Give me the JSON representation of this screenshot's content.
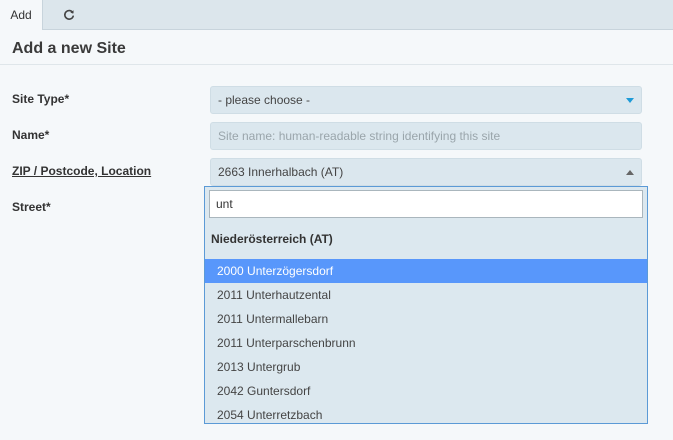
{
  "tabs": {
    "add_label": "Add"
  },
  "page": {
    "title": "Add a new Site"
  },
  "form": {
    "site_type": {
      "label": "Site Type*",
      "value": "- please choose -"
    },
    "name": {
      "label": "Name*",
      "value": "",
      "placeholder": "Site name: human-readable string identifying this site"
    },
    "location": {
      "label": "ZIP / Postcode, Location",
      "value": "2663 Innerhalbach (AT)"
    },
    "street": {
      "label": "Street*"
    }
  },
  "dropdown": {
    "search_value": "unt",
    "group_label": "Niederösterreich (AT)",
    "options": [
      "2000 Unterzögersdorf",
      "2011 Unterhautzental",
      "2011 Untermallebarn",
      "2011 Unterparschenbrunn",
      "2013 Untergrub",
      "2042 Guntersdorf",
      "2054 Unterretzbach"
    ],
    "selected_index": 0
  },
  "colors": {
    "highlight": "#5897fb",
    "field_bg": "#dbe7ee",
    "accent_arrow": "#1e9bd7"
  }
}
